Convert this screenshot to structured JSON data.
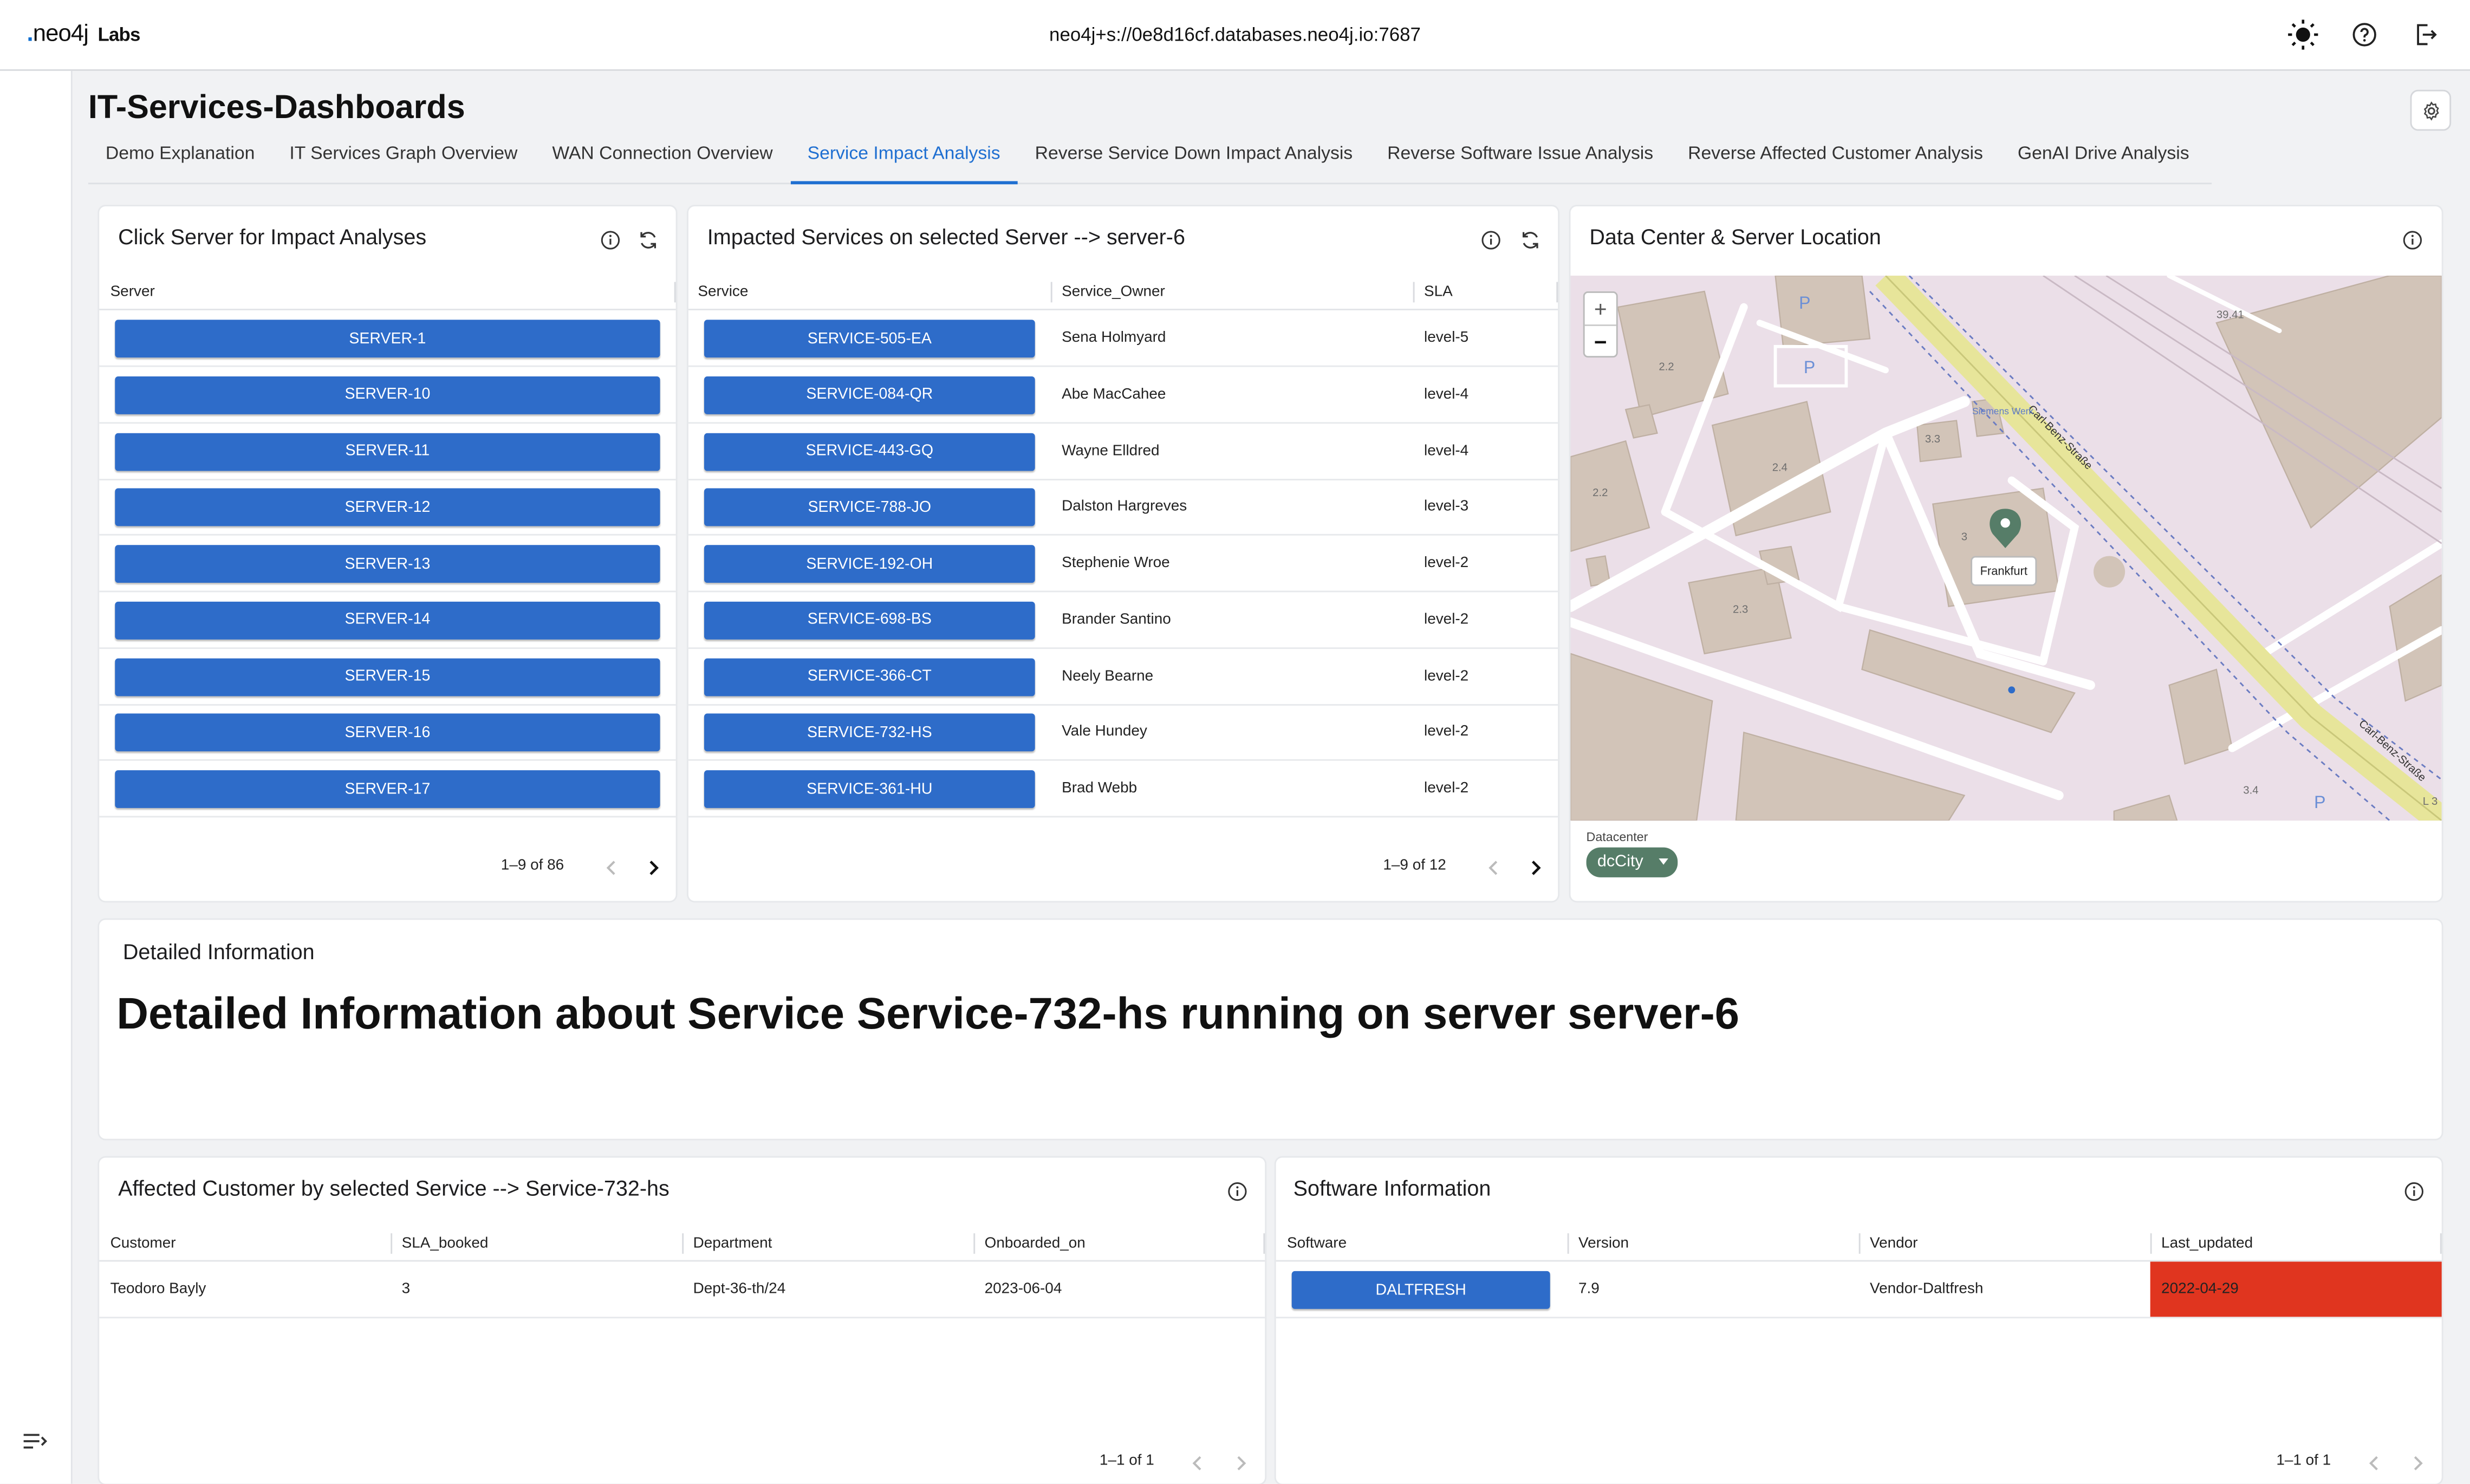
{
  "app": {
    "logo_text": "neo4j",
    "logo_suffix": "Labs",
    "connection": "neo4j+s://0e8d16cf.databases.neo4j.io:7687"
  },
  "dashboard": {
    "title": "IT-Services-Dashboards",
    "tabs": [
      {
        "label": "Demo Explanation",
        "active": false
      },
      {
        "label": "IT Services Graph Overview",
        "active": false
      },
      {
        "label": "WAN Connection Overview",
        "active": false
      },
      {
        "label": "Service Impact Analysis",
        "active": true
      },
      {
        "label": "Reverse Service Down Impact Analysis",
        "active": false
      },
      {
        "label": "Reverse Software Issue Analysis",
        "active": false
      },
      {
        "label": "Reverse Affected Customer Analysis",
        "active": false
      },
      {
        "label": "GenAI Drive Analysis",
        "active": false
      }
    ]
  },
  "servers": {
    "title": "Click Server for Impact Analyses",
    "column": "Server",
    "rows": [
      "SERVER-1",
      "SERVER-10",
      "SERVER-11",
      "SERVER-12",
      "SERVER-13",
      "SERVER-14",
      "SERVER-15",
      "SERVER-16",
      "SERVER-17"
    ],
    "pagination": "1–9 of 86"
  },
  "services": {
    "title": "Impacted Services on selected Server --> server-6",
    "columns": [
      "Service",
      "Service_Owner",
      "SLA"
    ],
    "rows": [
      {
        "service": "SERVICE-505-EA",
        "owner": "Sena Holmyard",
        "sla": "level-5"
      },
      {
        "service": "SERVICE-084-QR",
        "owner": "Abe MacCahee",
        "sla": "level-4"
      },
      {
        "service": "SERVICE-443-GQ",
        "owner": "Wayne Elldred",
        "sla": "level-4"
      },
      {
        "service": "SERVICE-788-JO",
        "owner": "Dalston Hargreves",
        "sla": "level-3"
      },
      {
        "service": "SERVICE-192-OH",
        "owner": "Stephenie Wroe",
        "sla": "level-2"
      },
      {
        "service": "SERVICE-698-BS",
        "owner": "Brander Santino",
        "sla": "level-2"
      },
      {
        "service": "SERVICE-366-CT",
        "owner": "Neely Bearne",
        "sla": "level-2"
      },
      {
        "service": "SERVICE-732-HS",
        "owner": "Vale Hundey",
        "sla": "level-2"
      },
      {
        "service": "SERVICE-361-HU",
        "owner": "Brad Webb",
        "sla": "level-2"
      }
    ],
    "pagination": "1–9 of 12"
  },
  "location": {
    "title": "Data Center & Server Location",
    "marker_label": "Frankfurt",
    "map_labels": {
      "street1": "Carl-Benz-Straße",
      "street2": "Carl-Benz-Straße",
      "poi": "Siemens Werk",
      "b1": "2.2",
      "b2": "2.4",
      "b3": "2.2",
      "b4": "2.3",
      "b5": "3.3",
      "b6": "3.4",
      "b7": "39.41",
      "b8": "3",
      "b9": "L 3",
      "p1": "P",
      "p2": "P",
      "p3": "P"
    },
    "datacenter_label": "Datacenter",
    "datacenter_value": "dcCity",
    "zoom_in": "+",
    "zoom_out": "−"
  },
  "details": {
    "title": "Detailed Information",
    "heading": "Detailed Information about Service Service-732-hs running on server server-6"
  },
  "customers": {
    "title": "Affected Customer by selected Service --> Service-732-hs",
    "columns": [
      "Customer",
      "SLA_booked",
      "Department",
      "Onboarded_on"
    ],
    "rows": [
      {
        "customer": "Teodoro Bayly",
        "sla_booked": "3",
        "department": "Dept-36-th/24",
        "onboarded_on": "2023-06-04"
      }
    ],
    "pagination": "1–1 of 1"
  },
  "software": {
    "title": "Software Information",
    "columns": [
      "Software",
      "Version",
      "Vendor",
      "Last_updated"
    ],
    "rows": [
      {
        "software": "DALTFRESH",
        "version": "7.9",
        "vendor": "Vendor-Daltfresh",
        "last_updated": "2022-04-29"
      }
    ],
    "pagination": "1–1 of 1",
    "alert_color": "#e0351f"
  },
  "colors": {
    "accent": "#1f6fd1",
    "button": "#2e6cc9",
    "chip": "#567d68"
  },
  "icons": [
    "sun-icon",
    "help-icon",
    "logout-icon",
    "gear-icon",
    "info-icon",
    "refresh-icon",
    "chevron-left-icon",
    "chevron-right-icon",
    "sidebar-toggle-icon",
    "map-pin-icon"
  ]
}
